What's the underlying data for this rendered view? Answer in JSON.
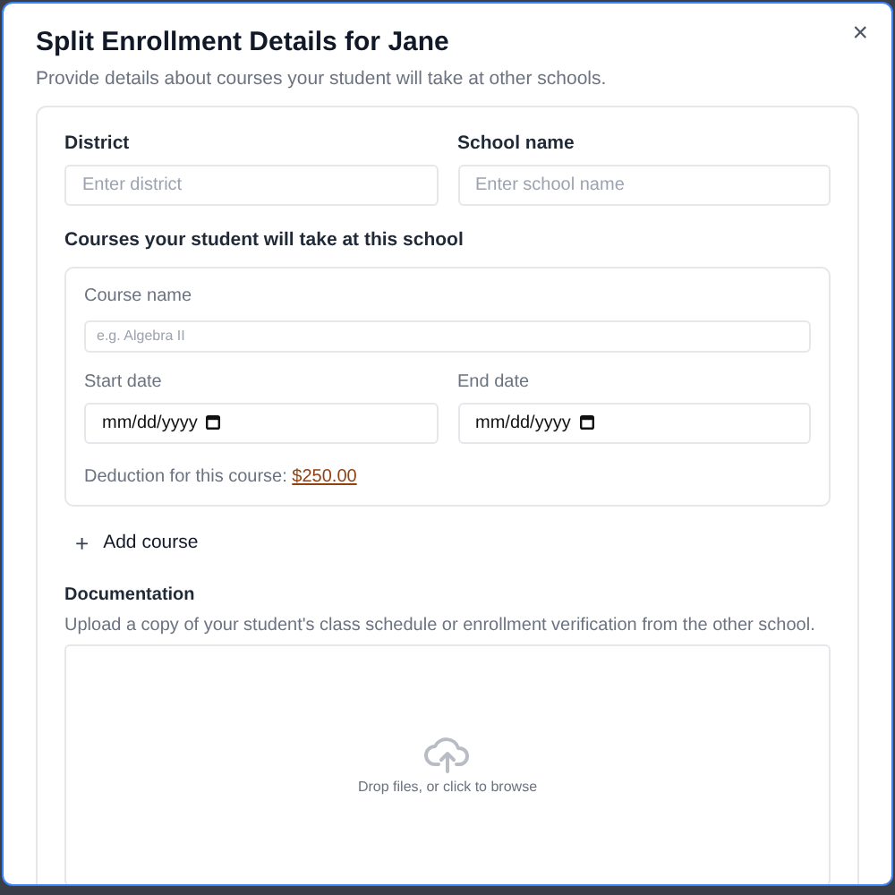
{
  "dialog": {
    "title": "Split Enrollment Details for Jane",
    "subtitle": "Provide details about courses your student will take at other schools.",
    "close": "×"
  },
  "fields": [
    {
      "label": "District",
      "placeholder": "Enter district"
    },
    {
      "label": "School name",
      "placeholder": "Enter school name"
    }
  ],
  "courses_heading": "Courses your student will take at this school",
  "course": {
    "name_label": "Course name",
    "name_placeholder": "e.g. Algebra II",
    "dates": [
      {
        "label": "Start date",
        "placeholder": "mm/dd/yyyy"
      },
      {
        "label": "End date",
        "placeholder": "mm/dd/yyyy"
      }
    ],
    "deduction_label": "Deduction for this course:",
    "deduction_amount": "$250.00"
  },
  "add_course": {
    "icon": "+",
    "label": "Add course"
  },
  "documentation": {
    "heading": "Documentation",
    "description": "Upload a copy of your student's class schedule or enrollment verification from the other school.",
    "dropzone_text": "Drop files, or click to browse"
  }
}
